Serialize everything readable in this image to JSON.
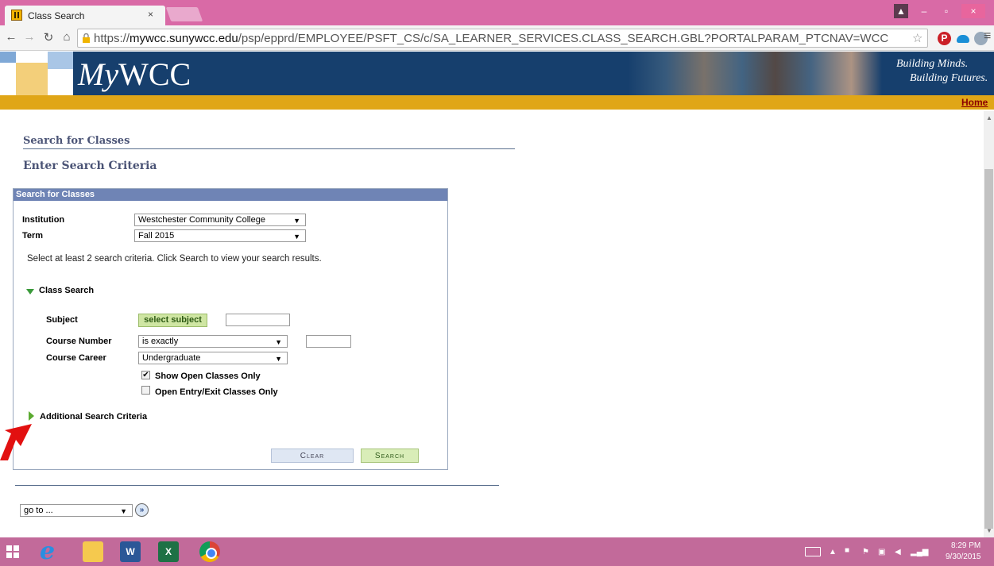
{
  "browser": {
    "tab_title": "Class Search",
    "tab_close": "×",
    "url_prefix": "https://",
    "url_domain": "mywcc.sunywcc.edu",
    "url_path": "/psp/epprd/EMPLOYEE/PSFT_CS/c/SA_LEARNER_SERVICES.CLASS_SEARCH.GBL?PORTALPARAM_PTCNAV=WCC",
    "window_min": "–",
    "window_max": "▫",
    "window_close": "×"
  },
  "banner": {
    "logo_my": "My",
    "logo_wcc": "WCC",
    "tagline_1": "Building Minds.",
    "tagline_2": "Building Futures.",
    "home_link": "Home"
  },
  "page": {
    "title": "Search for Classes",
    "subtitle": "Enter Search Criteria"
  },
  "search_box": {
    "header": "Search for Classes",
    "institution_label": "Institution",
    "institution_value": "Westchester Community College",
    "term_label": "Term",
    "term_value": "Fall 2015",
    "instructions": "Select at least 2 search criteria. Click Search to view your search results.",
    "class_search_section": "Class Search",
    "subject_label": "Subject",
    "select_subject_button": "select subject",
    "subject_value": "",
    "course_number_label": "Course Number",
    "course_number_operator": "is exactly",
    "course_number_value": "",
    "course_career_label": "Course Career",
    "course_career_value": "Undergraduate",
    "show_open_label": "Show Open Classes Only",
    "show_open_checked": true,
    "open_entry_label": "Open Entry/Exit Classes Only",
    "open_entry_checked": false,
    "additional_criteria": "Additional Search Criteria",
    "clear_button": "Clear",
    "search_button": "Search"
  },
  "footer_nav": {
    "goto_value": "go to ...",
    "goto_button": "»"
  },
  "taskbar": {
    "word_label": "W",
    "excel_label": "X",
    "clock_time": "8:29 PM",
    "clock_date": "9/30/2015"
  },
  "colors": {
    "banner_blue": "#163f6d",
    "gold_bar": "#e0a617",
    "box_header": "#6f84b5",
    "heading": "#4b5476",
    "taskbar": "#c26a9a"
  }
}
